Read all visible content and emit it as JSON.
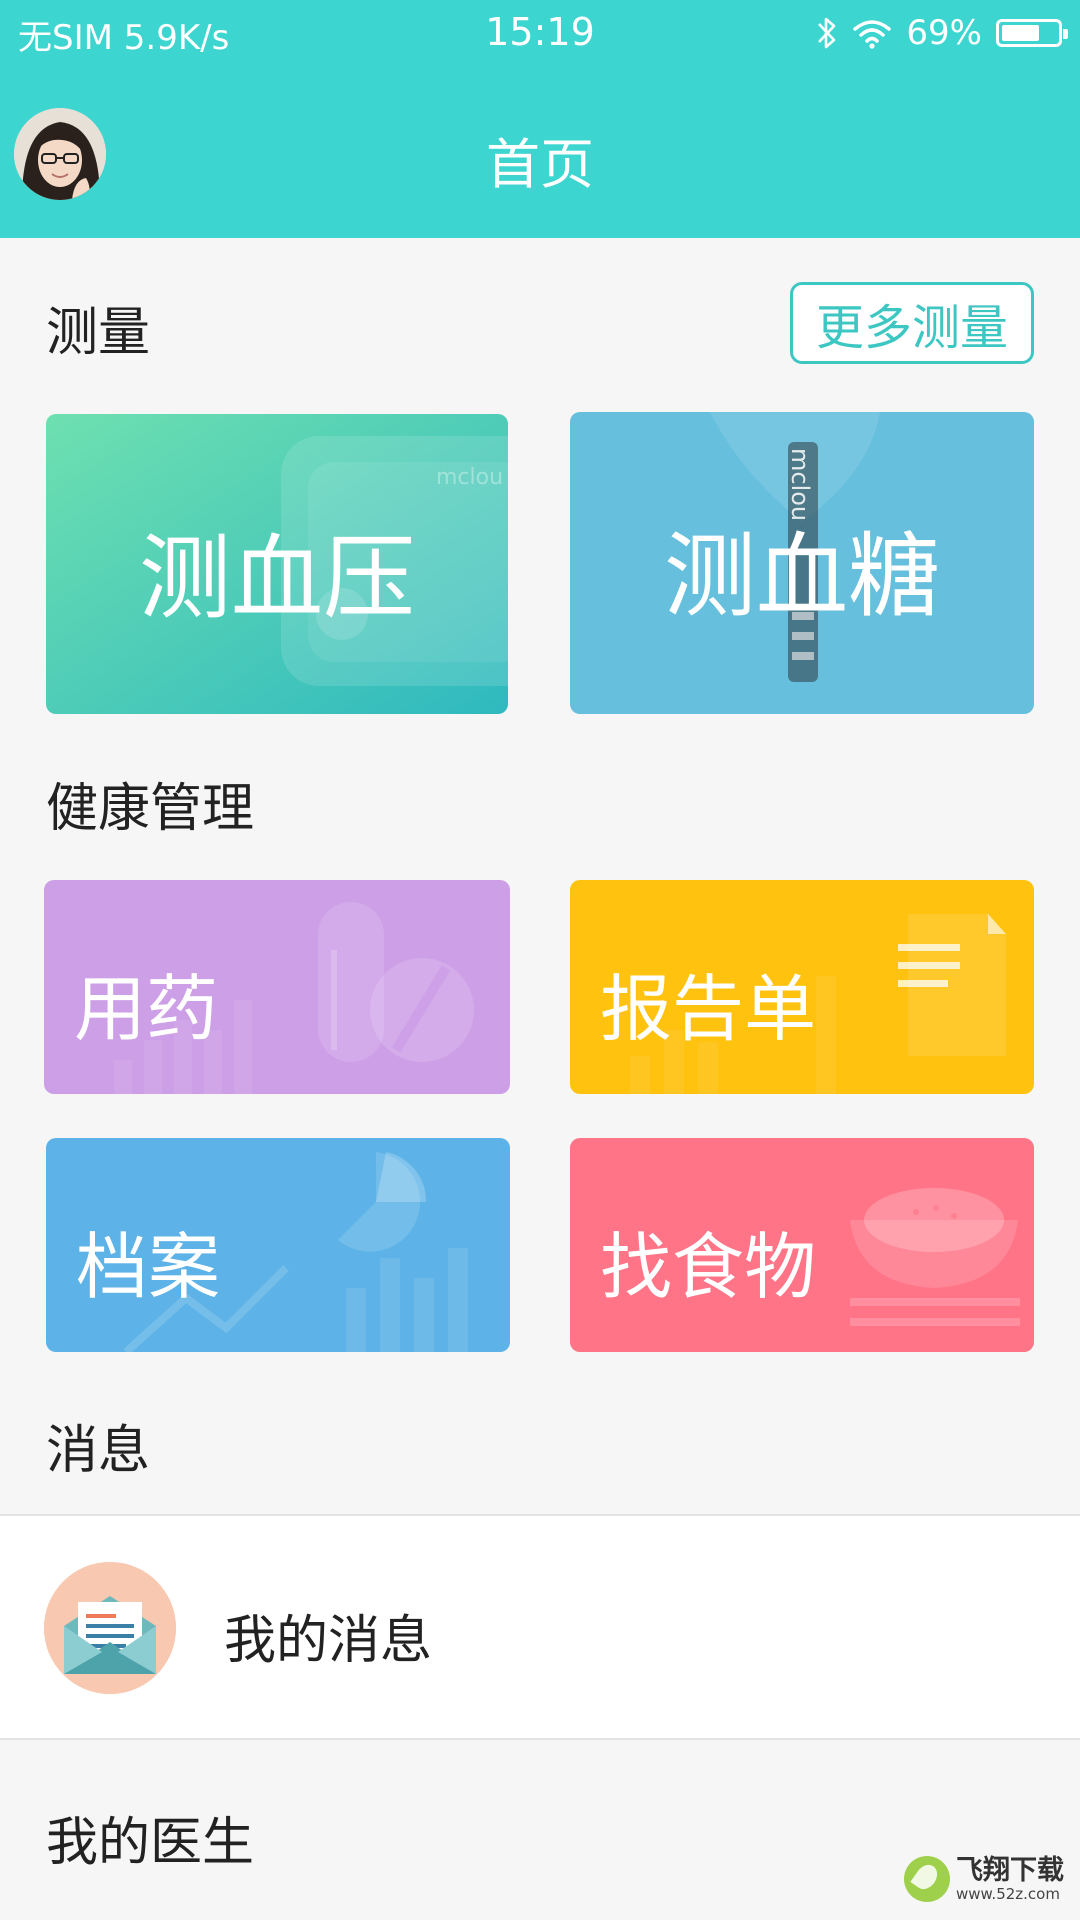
{
  "status_bar": {
    "carrier_speed": "无SIM 5.9K/s",
    "time": "15:19",
    "battery_text": "69%",
    "battery_level": 0.69,
    "icons": [
      "bluetooth-icon",
      "wifi-icon",
      "battery-icon"
    ]
  },
  "header": {
    "title": "首页",
    "avatar": "avatar"
  },
  "measure": {
    "section_title": "测量",
    "more_button": "更多测量",
    "cards": [
      {
        "label": "测血压",
        "color": "#5fd6b4"
      },
      {
        "label": "测血糖",
        "color": "#66c0df"
      }
    ]
  },
  "health": {
    "section_title": "健康管理",
    "cards": [
      {
        "label": "用药",
        "color": "#cf9fe8",
        "icon": "pill-icon"
      },
      {
        "label": "报告单",
        "color": "#ffc20e",
        "icon": "document-icon"
      },
      {
        "label": "档案",
        "color": "#5fb2e7",
        "icon": "pie-chart-icon"
      },
      {
        "label": "找食物",
        "color": "#ff7585",
        "icon": "rice-bowl-icon"
      }
    ]
  },
  "messages": {
    "section_title": "消息",
    "my_messages": "我的消息",
    "icon": "envelope-icon"
  },
  "doctor": {
    "section_title": "我的医生"
  },
  "watermark": {
    "name": "飞翔下载",
    "url": "www.52z.com"
  },
  "colors": {
    "brand": "#3dd5cf",
    "background": "#f6f6f6"
  }
}
